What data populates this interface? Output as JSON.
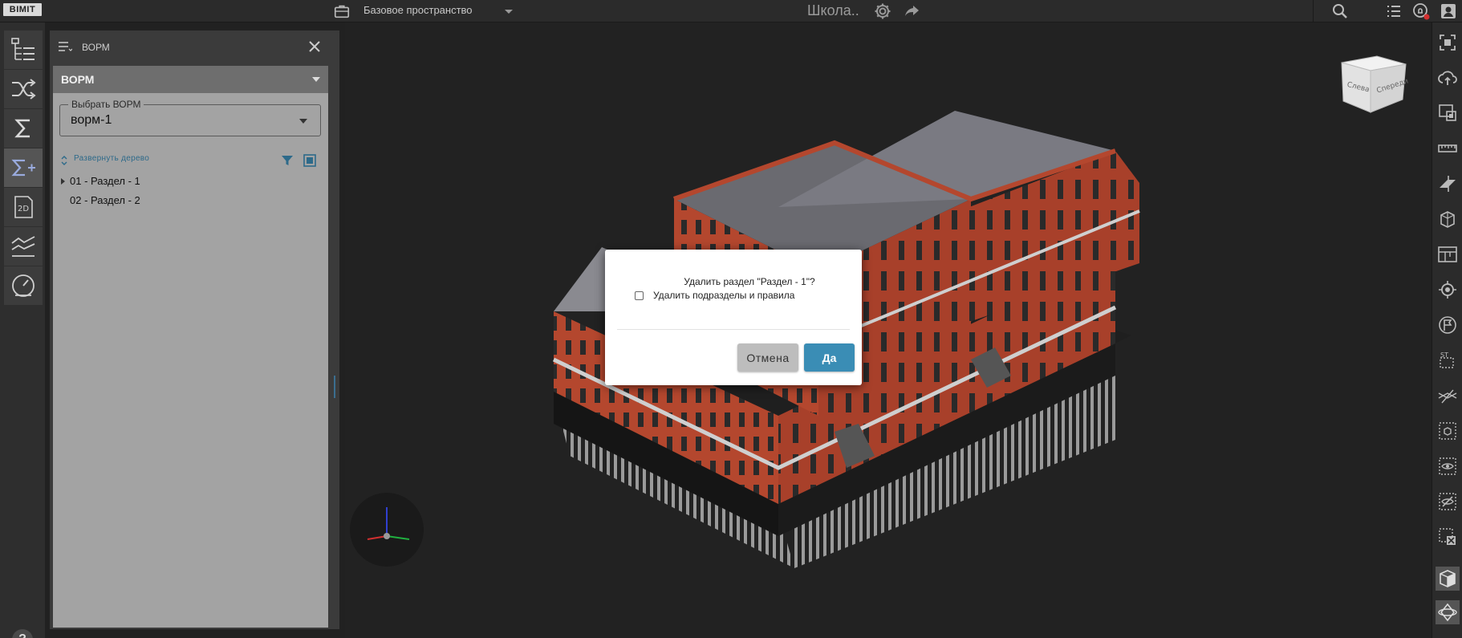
{
  "topbar": {
    "logo": "BIMIT",
    "space_name": "Базовое пространство",
    "project_name": "Школа.."
  },
  "left_toolbar": {
    "tools": [
      "model-tree-icon",
      "shuffle-icon",
      "sigma-icon",
      "sigma-plus-icon",
      "2d-drawing-icon",
      "chart-lines-icon",
      "gauge-icon"
    ],
    "help_label": "?"
  },
  "panel": {
    "title": "ВОРМ",
    "section_label": "ВОРМ",
    "select": {
      "legend": "Выбрать ВОРМ",
      "value": "ворм-1"
    },
    "expand_tree_label": "Развернуть дерево",
    "tree": [
      {
        "label": "01 - Раздел - 1",
        "has_children": true
      },
      {
        "label": "02 - Раздел - 2",
        "has_children": false
      }
    ]
  },
  "viewport": {
    "navcube_left": "Слева",
    "navcube_front": "Спереди"
  },
  "dialog": {
    "question": "Удалить раздел \"Раздел - 1\"?",
    "checkbox_label": "Удалить подразделы и правила",
    "checkbox_checked": false,
    "cancel_label": "Отмена",
    "confirm_label": "Да"
  },
  "colors": {
    "accent": "#3a8db5",
    "link": "#2d6a8a",
    "panel_body": "#a3a3a3",
    "brick": "#b4472e"
  }
}
